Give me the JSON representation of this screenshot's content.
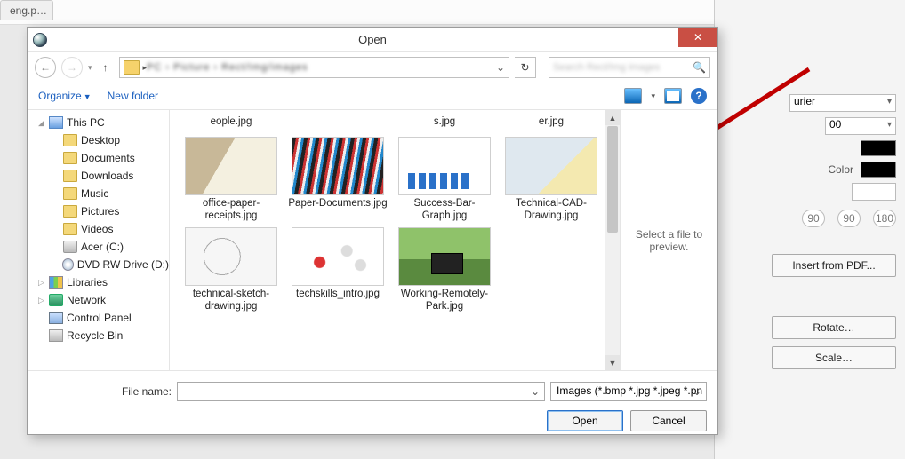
{
  "host": {
    "tab_title": "eng.p…",
    "font_dropdown": "urier",
    "size_dropdown": "00",
    "color_label": "Color",
    "rot": [
      "90",
      "90",
      "180"
    ],
    "buttons": {
      "insert_pdf": "Insert from PDF...",
      "rotate": "Rotate…",
      "scale": "Scale…"
    }
  },
  "dialog": {
    "title": "Open",
    "breadcrumb": "PC › Picture › Rect/Img/images",
    "search_placeholder": "Search Rect/Img images",
    "organize": "Organize",
    "new_folder": "New folder",
    "tree": [
      {
        "lvl": 1,
        "tri": "◢",
        "icon": "pc",
        "label": "This PC"
      },
      {
        "lvl": 2,
        "icon": "folder",
        "label": "Desktop"
      },
      {
        "lvl": 2,
        "icon": "folder",
        "label": "Documents"
      },
      {
        "lvl": 2,
        "icon": "folder",
        "label": "Downloads"
      },
      {
        "lvl": 2,
        "icon": "folder",
        "label": "Music"
      },
      {
        "lvl": 2,
        "icon": "folder",
        "label": "Pictures"
      },
      {
        "lvl": 2,
        "icon": "folder",
        "label": "Videos"
      },
      {
        "lvl": 2,
        "icon": "drive",
        "label": "Acer (C:)"
      },
      {
        "lvl": 2,
        "icon": "disc",
        "label": "DVD RW Drive (D:)"
      },
      {
        "lvl": 1,
        "tri": "▷",
        "icon": "lib",
        "label": "Libraries"
      },
      {
        "lvl": 1,
        "tri": "▷",
        "icon": "net",
        "label": "Network"
      },
      {
        "lvl": 1,
        "tri": "",
        "icon": "cp",
        "label": "Control Panel"
      },
      {
        "lvl": 1,
        "tri": "",
        "icon": "bin",
        "label": "Recycle Bin"
      }
    ],
    "partial_row": [
      "eople.jpg",
      "",
      "s.jpg",
      "er.jpg"
    ],
    "files": [
      {
        "cap": "office-paper-receipts.jpg",
        "th": "th-office"
      },
      {
        "cap": "Paper-Documents.jpg",
        "th": "th-paper"
      },
      {
        "cap": "Success-Bar-Graph.jpg",
        "th": "th-bars"
      },
      {
        "cap": "Technical-CAD-Drawing.jpg",
        "th": "th-cad"
      },
      {
        "cap": "technical-sketch-drawing.jpg",
        "th": "th-sketch"
      },
      {
        "cap": "techskills_intro.jpg",
        "th": "th-skills"
      },
      {
        "cap": "Working-Remotely-Park.jpg",
        "th": "th-park"
      }
    ],
    "preview_hint": "Select a file to preview.",
    "filename_label": "File name:",
    "filter": "Images (*.bmp *.jpg *.jpeg *.pn",
    "open_btn": "Open",
    "cancel_btn": "Cancel"
  }
}
